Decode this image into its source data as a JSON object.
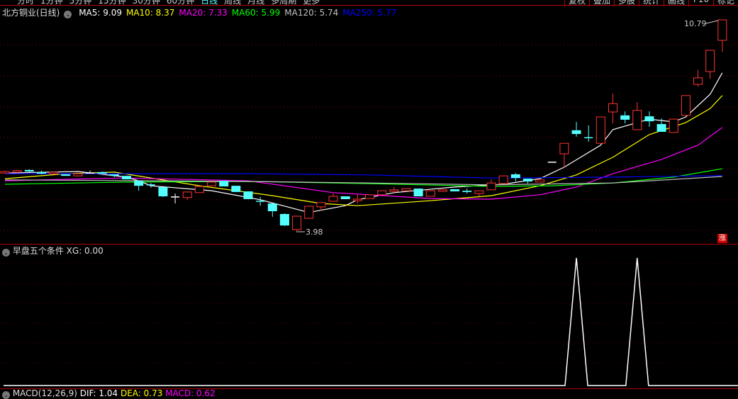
{
  "toolbar": {
    "tabs": [
      "分时",
      "1分钟",
      "5分钟",
      "15分钟",
      "30分钟",
      "60分钟",
      "日线",
      "周线",
      "月线",
      "多周期",
      "更多"
    ],
    "active_tab": "日线",
    "right_buttons": [
      "复权",
      "叠加",
      "多股",
      "统计",
      "画线",
      "F10",
      "标记"
    ]
  },
  "main": {
    "title": "北方铜业(日线)",
    "ma": [
      {
        "label": "MA5: 9.09",
        "color": "#ffffff"
      },
      {
        "label": "MA10: 8.37",
        "color": "#ffff00"
      },
      {
        "label": "MA20: 7.33",
        "color": "#ff00ff"
      },
      {
        "label": "MA60: 5.99",
        "color": "#00ff00"
      },
      {
        "label": "MA120: 5.74",
        "color": "#c0c0c0"
      },
      {
        "label": "MA250: 5.77",
        "color": "#0000ff"
      }
    ],
    "high_label": "10.79",
    "low_label": "3.98",
    "zhang_badge": "涨"
  },
  "indicator": {
    "title": "早盘五个条件",
    "value_label": "XG: 0.00"
  },
  "macd": {
    "title": "MACD(12,26,9)",
    "dif": "DIF: 1.04",
    "dea": "DEA: 0.73",
    "macd": "MACD: 0.62"
  },
  "colors": {
    "up": "#ff3232",
    "down": "#54ffff",
    "grid": "#800000",
    "border": "#b00000"
  },
  "chart_data": {
    "type": "candlestick",
    "ylim": [
      3.9,
      10.9
    ],
    "candles": [
      [
        5.85,
        5.93,
        5.83,
        5.9
      ],
      [
        5.88,
        5.95,
        5.85,
        5.93
      ],
      [
        5.95,
        5.97,
        5.88,
        5.9
      ],
      [
        5.88,
        5.93,
        5.81,
        5.83
      ],
      [
        5.83,
        5.9,
        5.81,
        5.88
      ],
      [
        5.81,
        5.83,
        5.76,
        5.76
      ],
      [
        5.76,
        5.83,
        5.74,
        5.83
      ],
      [
        5.85,
        5.93,
        5.85,
        5.85
      ],
      [
        5.88,
        5.9,
        5.83,
        5.83
      ],
      [
        5.81,
        5.81,
        5.72,
        5.76
      ],
      [
        5.76,
        5.76,
        5.65,
        5.65
      ],
      [
        5.6,
        5.6,
        5.28,
        5.44
      ],
      [
        5.47,
        5.53,
        5.38,
        5.44
      ],
      [
        5.4,
        5.4,
        5.08,
        5.1
      ],
      [
        5.08,
        5.19,
        4.87,
        5.08
      ],
      [
        5.06,
        5.24,
        4.99,
        5.24
      ],
      [
        5.22,
        5.42,
        5.22,
        5.42
      ],
      [
        5.44,
        5.56,
        5.42,
        5.56
      ],
      [
        5.6,
        5.6,
        5.42,
        5.42
      ],
      [
        5.44,
        5.44,
        5.24,
        5.24
      ],
      [
        5.26,
        5.26,
        5.01,
        5.01
      ],
      [
        4.94,
        5.08,
        4.8,
        4.94
      ],
      [
        4.87,
        4.87,
        4.44,
        4.62
      ],
      [
        4.53,
        4.55,
        4.14,
        4.16
      ],
      [
        4.03,
        4.46,
        3.98,
        4.46
      ],
      [
        4.39,
        4.78,
        4.39,
        4.78
      ],
      [
        4.76,
        4.9,
        4.64,
        4.9
      ],
      [
        4.94,
        5.19,
        4.94,
        5.1
      ],
      [
        5.1,
        5.1,
        5.01,
        5.01
      ],
      [
        4.96,
        5.15,
        4.87,
        5.01
      ],
      [
        5.03,
        5.15,
        5.03,
        5.15
      ],
      [
        5.15,
        5.28,
        5.15,
        5.28
      ],
      [
        5.26,
        5.4,
        5.22,
        5.31
      ],
      [
        5.28,
        5.35,
        5.28,
        5.35
      ],
      [
        5.35,
        5.35,
        5.1,
        5.1
      ],
      [
        5.1,
        5.28,
        5.1,
        5.28
      ],
      [
        5.26,
        5.31,
        5.26,
        5.31
      ],
      [
        5.33,
        5.33,
        5.26,
        5.26
      ],
      [
        5.28,
        5.35,
        5.19,
        5.24
      ],
      [
        5.19,
        5.28,
        5.1,
        5.28
      ],
      [
        5.31,
        5.65,
        5.31,
        5.53
      ],
      [
        5.51,
        5.76,
        5.51,
        5.76
      ],
      [
        5.81,
        5.85,
        5.58,
        5.69
      ],
      [
        5.67,
        5.67,
        5.51,
        5.58
      ],
      [
        5.56,
        5.63,
        5.56,
        5.63
      ],
      [
        6.2,
        6.2,
        6.2,
        6.2
      ],
      [
        6.47,
        6.81,
        6.04,
        6.81
      ],
      [
        7.23,
        7.5,
        7.02,
        7.11
      ],
      [
        6.99,
        7.39,
        6.86,
        6.99
      ],
      [
        6.81,
        7.66,
        6.81,
        7.66
      ],
      [
        7.82,
        8.41,
        7.45,
        8.09
      ],
      [
        7.71,
        7.84,
        7.45,
        7.57
      ],
      [
        7.25,
        8.14,
        7.25,
        7.87
      ],
      [
        7.68,
        7.84,
        7.34,
        7.52
      ],
      [
        7.43,
        7.61,
        7.18,
        7.18
      ],
      [
        7.16,
        7.59,
        7.16,
        7.59
      ],
      [
        7.71,
        8.35,
        7.71,
        8.35
      ],
      [
        8.71,
        9.17,
        8.64,
        8.92
      ],
      [
        9.12,
        9.81,
        8.89,
        9.81
      ],
      [
        10.13,
        10.79,
        9.76,
        10.79
      ]
    ],
    "ma_series": [
      {
        "name": "MA5",
        "color": "#ffffff",
        "points": [
          [
            0,
            5.85
          ],
          [
            6,
            5.9
          ],
          [
            10,
            5.72
          ],
          [
            11,
            5.6
          ],
          [
            12,
            5.44
          ],
          [
            17,
            5.28
          ],
          [
            21,
            4.99
          ],
          [
            25,
            4.58
          ],
          [
            28,
            4.8
          ],
          [
            29,
            4.99
          ],
          [
            32,
            5.22
          ],
          [
            37,
            5.4
          ],
          [
            41,
            5.49
          ],
          [
            44,
            5.67
          ],
          [
            46,
            6.04
          ],
          [
            49,
            6.75
          ],
          [
            50,
            7.25
          ],
          [
            53,
            7.59
          ],
          [
            55,
            7.5
          ],
          [
            56,
            7.66
          ],
          [
            58,
            8.39
          ],
          [
            59,
            9.08
          ]
        ]
      },
      {
        "name": "MA10",
        "color": "#ffff00",
        "points": [
          [
            0,
            5.67
          ],
          [
            5,
            5.83
          ],
          [
            9,
            5.88
          ],
          [
            16,
            5.44
          ],
          [
            22,
            5.12
          ],
          [
            26,
            4.87
          ],
          [
            29,
            4.8
          ],
          [
            35,
            4.96
          ],
          [
            40,
            5.12
          ],
          [
            44,
            5.44
          ],
          [
            47,
            5.79
          ],
          [
            50,
            6.36
          ],
          [
            53,
            7.09
          ],
          [
            56,
            7.48
          ],
          [
            58,
            7.93
          ],
          [
            59,
            8.35
          ]
        ]
      },
      {
        "name": "MA20",
        "color": "#ff00ff",
        "points": [
          [
            0,
            5.6
          ],
          [
            5,
            5.65
          ],
          [
            10,
            5.69
          ],
          [
            20,
            5.6
          ],
          [
            27,
            5.22
          ],
          [
            35,
            5.03
          ],
          [
            40,
            5.01
          ],
          [
            44,
            5.15
          ],
          [
            47,
            5.4
          ],
          [
            50,
            5.83
          ],
          [
            54,
            6.29
          ],
          [
            57,
            6.75
          ],
          [
            59,
            7.32
          ]
        ]
      },
      {
        "name": "MA60",
        "color": "#00ff00",
        "points": [
          [
            0,
            5.49
          ],
          [
            10,
            5.56
          ],
          [
            20,
            5.58
          ],
          [
            30,
            5.51
          ],
          [
            40,
            5.42
          ],
          [
            45,
            5.44
          ],
          [
            50,
            5.53
          ],
          [
            55,
            5.72
          ],
          [
            59,
            5.99
          ]
        ]
      },
      {
        "name": "MA120",
        "color": "#c0c0c0",
        "points": [
          [
            0,
            5.63
          ],
          [
            20,
            5.58
          ],
          [
            30,
            5.53
          ],
          [
            40,
            5.47
          ],
          [
            50,
            5.53
          ],
          [
            59,
            5.74
          ]
        ]
      },
      {
        "name": "MA250",
        "color": "#0000ff",
        "points": [
          [
            0,
            5.83
          ],
          [
            20,
            5.83
          ],
          [
            30,
            5.79
          ],
          [
            40,
            5.69
          ],
          [
            50,
            5.72
          ],
          [
            59,
            5.77
          ]
        ]
      }
    ],
    "xg": {
      "name": "XG",
      "signal_indices": [
        47,
        52
      ],
      "ylim": [
        0,
        1
      ]
    }
  }
}
